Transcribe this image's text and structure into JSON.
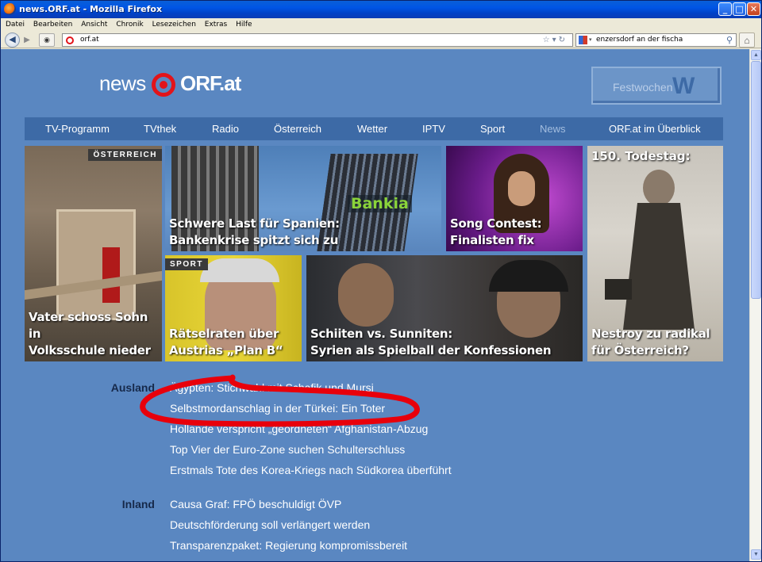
{
  "window": {
    "title": "news.ORF.at - Mozilla Firefox",
    "buttons": [
      "_",
      "□",
      "✕"
    ]
  },
  "menu": [
    "Datei",
    "Bearbeiten",
    "Ansicht",
    "Chronik",
    "Lesezeichen",
    "Extras",
    "Hilfe"
  ],
  "toolbar": {
    "url": "orf.at",
    "search_query": "enzersdorf an der fischa",
    "back_icon": "back-arrow-icon",
    "forward_icon": "forward-arrow-icon",
    "home_icon": "home-icon"
  },
  "site": {
    "logo_news": "news",
    "logo_orf": "ORF.at",
    "ad_text": "Festwochen",
    "ad_mark": "W",
    "nav": [
      "TV-Programm",
      "TVthek",
      "Radio",
      "Österreich",
      "Wetter",
      "IPTV",
      "Sport",
      "News",
      "ORF.at im Überblick"
    ],
    "nav_active": "News"
  },
  "tiles": [
    {
      "id": "oesterreich",
      "tag": "ÖSTERREICH",
      "caption": [
        "Vater schoss Sohn in",
        "Volksschule nieder"
      ]
    },
    {
      "id": "spanien",
      "tag": "",
      "caption": [
        "Schwere Last für Spanien:",
        "Bankenkrise spitzt sich zu"
      ],
      "sign": "Bankia"
    },
    {
      "id": "songcontest",
      "tag": "",
      "caption": [
        "Song Contest:",
        "Finalisten fix"
      ]
    },
    {
      "id": "nestroy",
      "tag": "",
      "headline": "150. Todestag:",
      "caption": [
        "Nestroy zu radikal",
        "für Österreich?"
      ]
    },
    {
      "id": "sport",
      "tag": "SPORT",
      "caption": [
        "Rätselraten über",
        "Austrias „Plan B“"
      ]
    },
    {
      "id": "syrien",
      "tag": "",
      "caption": [
        "Schiiten vs. Sunniten:",
        "Syrien als Spielball der Konfessionen"
      ]
    }
  ],
  "sections": [
    {
      "name": "Ausland",
      "items": [
        "Ägypten: Stichwahl mit Schafik und Mursi",
        "Selbstmordanschlag in der Türkei: Ein Toter",
        "Hollande verspricht „geordneten“ Afghanistan-Abzug",
        "Top Vier der Euro-Zone suchen Schulterschluss",
        "Erstmals Tote des Korea-Kriegs nach Südkorea überführt"
      ]
    },
    {
      "name": "Inland",
      "items": [
        "Causa Graf: FPÖ beschuldigt ÖVP",
        "Deutschförderung soll verlängert werden",
        "Transparenzpaket: Regierung kompromissbereit"
      ]
    }
  ],
  "colors": {
    "page_bg": "#5a87c1",
    "nav_bg": "#3d6aa6",
    "orf_red": "#e2141a",
    "highlight_circle": "#e8000b"
  }
}
